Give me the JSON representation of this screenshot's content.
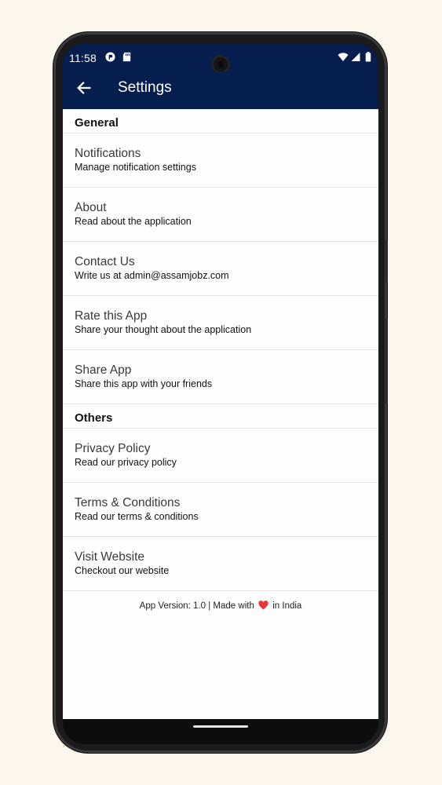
{
  "status_bar": {
    "time": "11:58",
    "icons": [
      "app-notification-icon",
      "sd-card-icon",
      "wifi-icon",
      "signal-icon",
      "battery-icon"
    ]
  },
  "app_bar": {
    "title": "Settings",
    "back_icon": "arrow-left-icon",
    "background": "#061e4d"
  },
  "sections": {
    "general": {
      "header": "General",
      "items": [
        {
          "title": "Notifications",
          "subtitle": "Manage notification settings"
        },
        {
          "title": "About",
          "subtitle": "Read about the application"
        },
        {
          "title": "Contact Us",
          "subtitle": "Write us at admin@assamjobz.com"
        },
        {
          "title": "Rate this App",
          "subtitle": "Share your thought about the application"
        },
        {
          "title": "Share App",
          "subtitle": "Share this app with your friends"
        }
      ]
    },
    "others": {
      "header": "Others",
      "items": [
        {
          "title": "Privacy Policy",
          "subtitle": "Read our privacy policy"
        },
        {
          "title": "Terms & Conditions",
          "subtitle": "Read our terms & conditions"
        },
        {
          "title": "Visit Website",
          "subtitle": "Checkout our website"
        }
      ]
    }
  },
  "footer": {
    "prefix": "App Version: 1.0 | Made with",
    "suffix": "in India",
    "heart_color": "#e53935"
  }
}
